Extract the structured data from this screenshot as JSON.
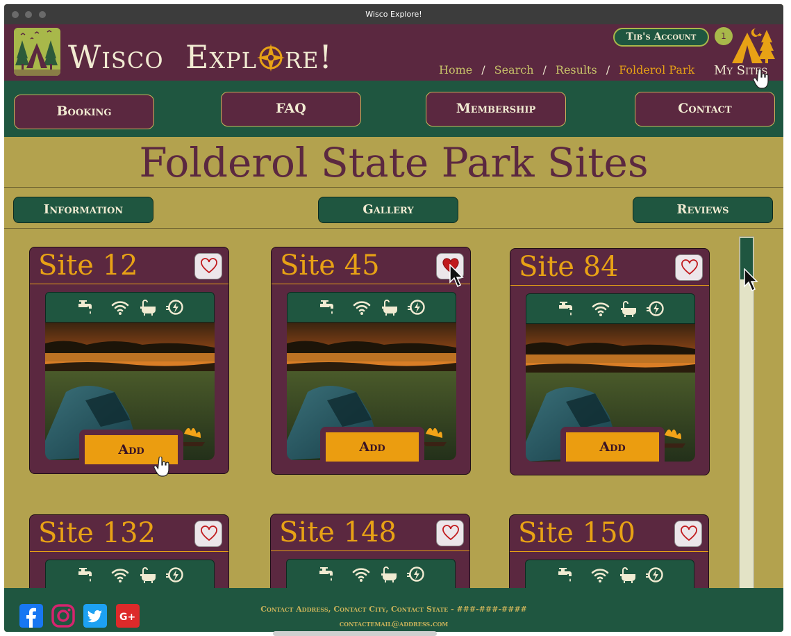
{
  "window": {
    "title": "Wisco Explore!"
  },
  "header": {
    "brand_part1": "Wisco",
    "brand_part2a": "Expl",
    "brand_part2b": "re!",
    "account_label": "Tib's Account",
    "cart_count": "1",
    "breadcrumbs": [
      "Home",
      "Search",
      "Results",
      "Folderol Park"
    ],
    "breadcrumb_separator": "/",
    "my_sites_label": "My Sites"
  },
  "nav": {
    "items": [
      "Booking",
      "FAQ",
      "Membership",
      "Contact"
    ]
  },
  "page": {
    "title": "Folderol State Park Sites",
    "subnav": [
      "Information",
      "Gallery",
      "Reviews"
    ]
  },
  "sites": [
    {
      "name": "Site 12",
      "favorited": false,
      "add_label": "Add"
    },
    {
      "name": "Site 45",
      "favorited": true,
      "add_label": "Add"
    },
    {
      "name": "Site 84",
      "favorited": false,
      "add_label": "Add"
    },
    {
      "name": "Site 132",
      "favorited": false
    },
    {
      "name": "Site 148",
      "favorited": false
    },
    {
      "name": "Site 150",
      "favorited": false
    }
  ],
  "amenities": [
    "water-faucet-icon",
    "wifi-icon",
    "bathtub-icon",
    "electric-hookup-icon"
  ],
  "footer": {
    "address_line": "Contact Address, Contact City, Contact State - ###-###-####",
    "email_line": "contactemail@address.com",
    "social": [
      "facebook-icon",
      "instagram-icon",
      "twitter-icon",
      "google-plus-icon"
    ]
  },
  "colors": {
    "maroon": "#5b2840",
    "forest_green": "#1f5640",
    "mustard": "#b3a24e",
    "orange": "#e8a215",
    "cream": "#f1ebd2",
    "heart_red": "#c0191c"
  }
}
